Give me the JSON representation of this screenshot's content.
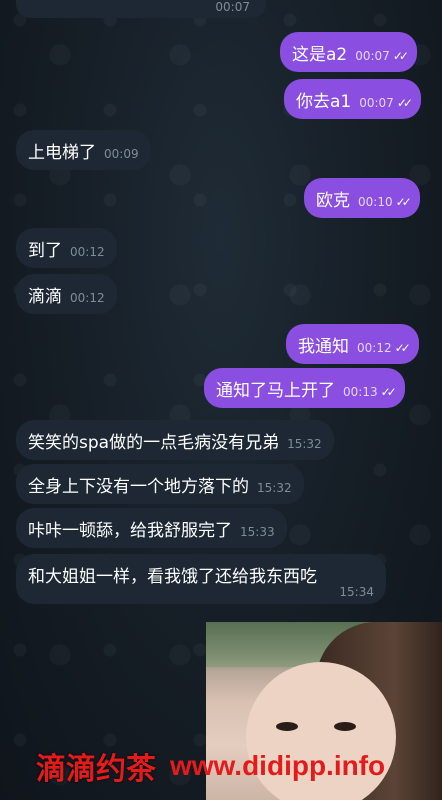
{
  "chat": {
    "top_fragment_time": "00:07",
    "messages": [
      {
        "text": "这是a2",
        "time": "00:07"
      },
      {
        "text": "你去a1",
        "time": "00:07"
      },
      {
        "text": "上电梯了",
        "time": "00:09"
      },
      {
        "text": "欧克",
        "time": "00:10"
      },
      {
        "text": "到了",
        "time": "00:12"
      },
      {
        "text": "滴滴",
        "time": "00:12"
      },
      {
        "text": "我通知",
        "time": "00:12"
      },
      {
        "text": "通知了马上开了",
        "time": "00:13"
      },
      {
        "text": "笑笑的spa做的一点毛病没有兄弟",
        "time": "15:32"
      },
      {
        "text": "全身上下没有一个地方落下的",
        "time": "15:32"
      },
      {
        "text": "咔咔一顿舔，给我舒服完了",
        "time": "15:33"
      },
      {
        "text": "和大姐姐一样，看我饿了还给我东西吃",
        "time": "15:34"
      }
    ],
    "read_checks": "✓✓"
  },
  "watermark": {
    "brand": "滴滴约茶",
    "url": "www.didipp.info"
  },
  "colors": {
    "outgoing_bubble": "#8a4fe0",
    "incoming_bubble": "#1d2834",
    "watermark": "#e51b1b"
  }
}
